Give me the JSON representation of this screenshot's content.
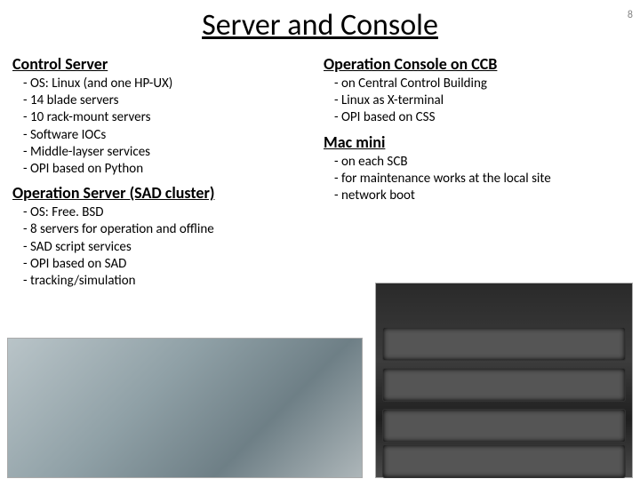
{
  "page_number": "8",
  "title": "Server and Console",
  "left": {
    "section1": {
      "heading": "Control Server",
      "items": [
        "- OS: Linux (and one HP-UX)",
        "- 14 blade servers",
        "- 10 rack-mount servers",
        "- Software IOCs",
        "- Middle-layser services",
        "- OPI based on Python"
      ]
    },
    "section2": {
      "heading": "Operation Server (SAD cluster)",
      "items": [
        "- OS: Free. BSD",
        "- 8 servers for operation and offline",
        "- SAD script services",
        "- OPI based on SAD",
        "- tracking/simulation"
      ]
    }
  },
  "right": {
    "section1": {
      "heading": "Operation Console on CCB",
      "items": [
        "- on Central Control Building",
        "- Linux as X-terminal",
        "- OPI based on CSS"
      ]
    },
    "section2": {
      "heading": "Mac mini",
      "items": [
        "- on each SCB",
        "- for maintenance works at the local site",
        "- network boot"
      ]
    }
  },
  "images": {
    "left_alt": "control-room-photo",
    "right_alt": "server-rack-photo"
  }
}
